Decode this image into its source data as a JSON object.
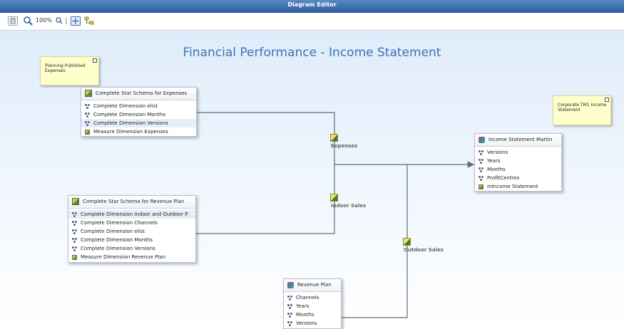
{
  "window": {
    "title": "Diagram Editor"
  },
  "toolbar": {
    "zoom_label": "100%"
  },
  "canvas": {
    "title": "Financial Performance - Income Statement",
    "notes": [
      {
        "text": "Planning Published Expenses"
      },
      {
        "text": "Corporate TM1 Income Statement"
      }
    ],
    "boxes": {
      "expenses_schema": {
        "title": "Complete Star Schema for Expenses",
        "rows": [
          {
            "label": "Complete Dimension elist",
            "kind": "dimension"
          },
          {
            "label": "Complete Dimension Months",
            "kind": "dimension"
          },
          {
            "label": "Complete Dimension Versions",
            "kind": "dimension"
          },
          {
            "label": "Measure Dimension Expenses",
            "kind": "measure"
          }
        ]
      },
      "revenue_schema": {
        "title": "Complete Star Schema for Revenue Plan",
        "rows": [
          {
            "label": "Complete Dimension Indoor and Outdoor P",
            "kind": "dimension"
          },
          {
            "label": "Complete Dimension Channels",
            "kind": "dimension"
          },
          {
            "label": "Complete Dimension elist",
            "kind": "dimension"
          },
          {
            "label": "Complete Dimension Months",
            "kind": "dimension"
          },
          {
            "label": "Complete Dimension Versions",
            "kind": "dimension"
          },
          {
            "label": "Measure Dimension Revenue Plan",
            "kind": "measure"
          }
        ]
      },
      "income_statement": {
        "title": "Income Statement Martin",
        "rows": [
          {
            "label": "Versions",
            "kind": "dimension"
          },
          {
            "label": "Years",
            "kind": "dimension"
          },
          {
            "label": "Months",
            "kind": "dimension"
          },
          {
            "label": "ProfitCentres",
            "kind": "dimension"
          },
          {
            "label": "mIncome Statement",
            "kind": "measure"
          }
        ]
      },
      "revenue_plan": {
        "title": "Revenue Plan",
        "rows": [
          {
            "label": "Channels",
            "kind": "dimension"
          },
          {
            "label": "Years",
            "kind": "dimension"
          },
          {
            "label": "Months",
            "kind": "dimension"
          },
          {
            "label": "Versions",
            "kind": "dimension"
          }
        ]
      }
    },
    "links": [
      {
        "label": "Expenses"
      },
      {
        "label": "Indoor Sales"
      },
      {
        "label": "Outdoor Sales"
      }
    ]
  },
  "icons": {
    "cube": "cube-icon",
    "star_schema": "star-schema-icon",
    "dimension": "dimension-icon",
    "measure": "measure-icon",
    "link_process": "link-process-icon"
  },
  "colors": {
    "title_blue": "#3d73b8",
    "titlebar": "#2e5f9e",
    "note_bg": "#ffffcc",
    "line": "#606a7a"
  }
}
